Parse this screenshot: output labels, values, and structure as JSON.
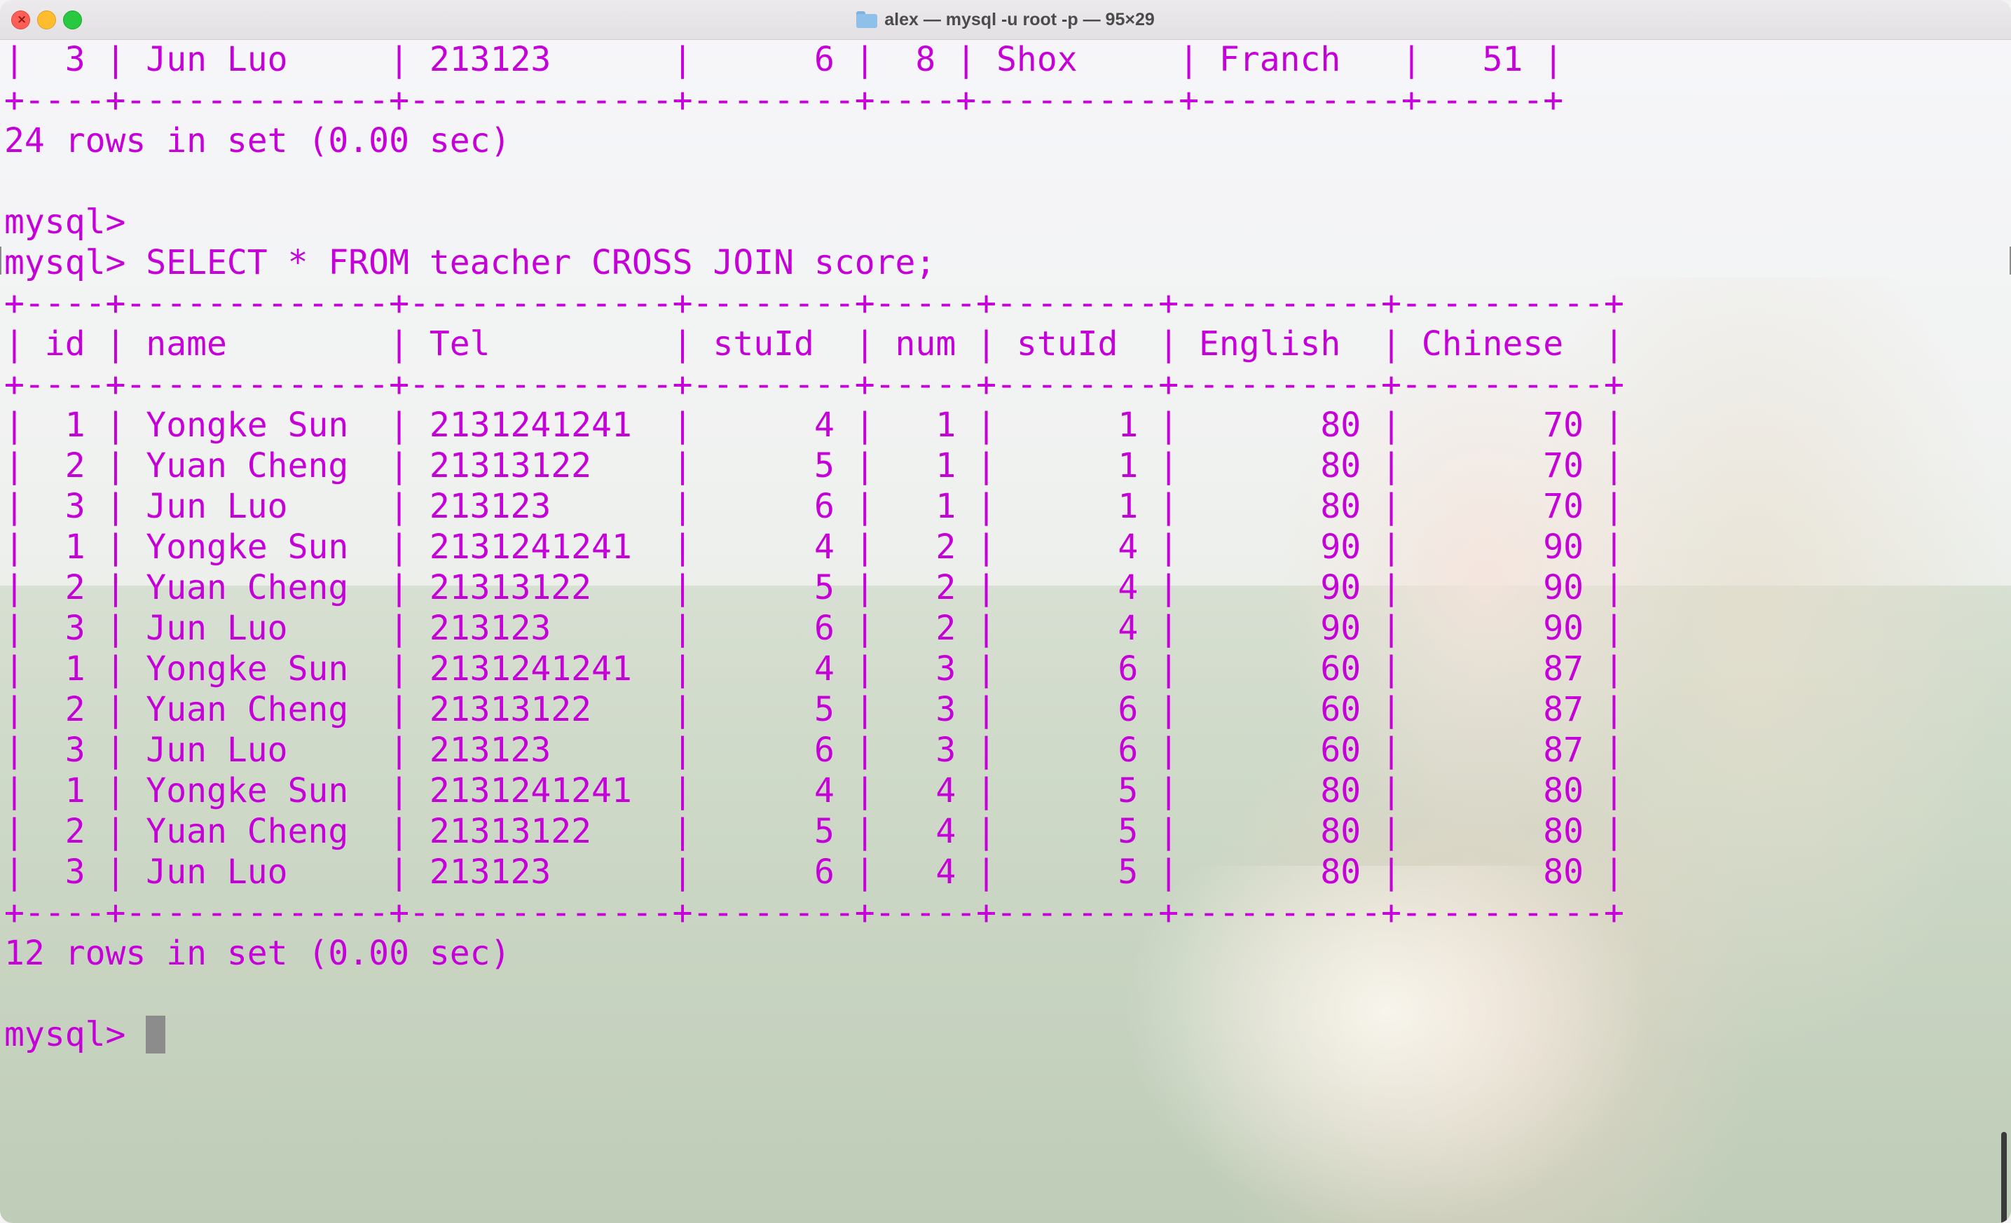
{
  "window": {
    "title": "alex — mysql -u root -p — 95×29",
    "folder_icon": "folder-icon",
    "controls": [
      "close-button",
      "minimize-button",
      "maximize-button"
    ]
  },
  "terminal": {
    "text_color": "#c500d8",
    "lines": [
      "|  3 | Jun Luo     | 213123      |      6 |  8 | Shox     | Franch   |   51 |",
      "+----+-------------+-------------+--------+----+----------+----------+------+",
      "24 rows in set (0.00 sec)",
      "",
      "mysql>",
      "mysql> SELECT * FROM teacher CROSS JOIN score;",
      "+----+-------------+-------------+--------+-----+--------+----------+----------+",
      "| id | name        | Tel         | stuId  | num | stuId  | English  | Chinese  |",
      "+----+-------------+-------------+--------+-----+--------+----------+----------+",
      "|  1 | Yongke Sun  | 2131241241  |      4 |   1 |      1 |       80 |       70 |",
      "|  2 | Yuan Cheng  | 21313122    |      5 |   1 |      1 |       80 |       70 |",
      "|  3 | Jun Luo     | 213123      |      6 |   1 |      1 |       80 |       70 |",
      "|  1 | Yongke Sun  | 2131241241  |      4 |   2 |      4 |       90 |       90 |",
      "|  2 | Yuan Cheng  | 21313122    |      5 |   2 |      4 |       90 |       90 |",
      "|  3 | Jun Luo     | 213123      |      6 |   2 |      4 |       90 |       90 |",
      "|  1 | Yongke Sun  | 2131241241  |      4 |   3 |      6 |       60 |       87 |",
      "|  2 | Yuan Cheng  | 21313122    |      5 |   3 |      6 |       60 |       87 |",
      "|  3 | Jun Luo     | 213123      |      6 |   3 |      6 |       60 |       87 |",
      "|  1 | Yongke Sun  | 2131241241  |      4 |   4 |      5 |       80 |       80 |",
      "|  2 | Yuan Cheng  | 21313122    |      5 |   4 |      5 |       80 |       80 |",
      "|  3 | Jun Luo     | 213123      |      6 |   4 |      5 |       80 |       80 |",
      "+----+-------------+-------------+--------+-----+--------+----------+----------+",
      "12 rows in set (0.00 sec)",
      "",
      "mysql> "
    ]
  }
}
